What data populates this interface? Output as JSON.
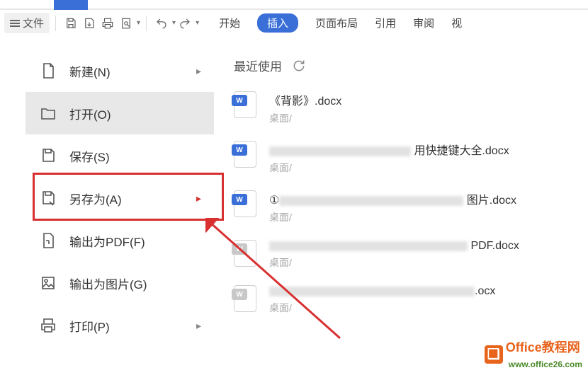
{
  "toolbar": {
    "file_label": "文件",
    "tabs": [
      "开始",
      "插入",
      "页面布局",
      "引用",
      "审阅",
      "视"
    ]
  },
  "sidebar": {
    "items": [
      {
        "label": "新建(N)",
        "has_arrow": true
      },
      {
        "label": "打开(O)"
      },
      {
        "label": "保存(S)"
      },
      {
        "label": "另存为(A)",
        "has_arrow": true,
        "highlighted": true
      },
      {
        "label": "输出为PDF(F)"
      },
      {
        "label": "输出为图片(G)"
      },
      {
        "label": "打印(P)",
        "has_arrow": true
      }
    ]
  },
  "content": {
    "recent_label": "最近使用",
    "files": [
      {
        "name": "《背影》.docx",
        "location": "桌面/",
        "badge": "blue"
      },
      {
        "name_suffix": "用快捷键大全.docx",
        "location": "桌面/",
        "badge": "blue",
        "blurred": true
      },
      {
        "name_prefix": "①",
        "name_suffix": "图片.docx",
        "location": "桌面/",
        "badge": "blue",
        "blurred": true
      },
      {
        "name_suffix": "PDF.docx",
        "location": "桌面/",
        "badge": "gray",
        "blurred": true
      },
      {
        "name_suffix": ".ocx",
        "location": "桌面/",
        "badge": "gray",
        "blurred": true
      }
    ]
  },
  "watermark": {
    "brand": "Office教程网",
    "url": "www.office26.com"
  }
}
